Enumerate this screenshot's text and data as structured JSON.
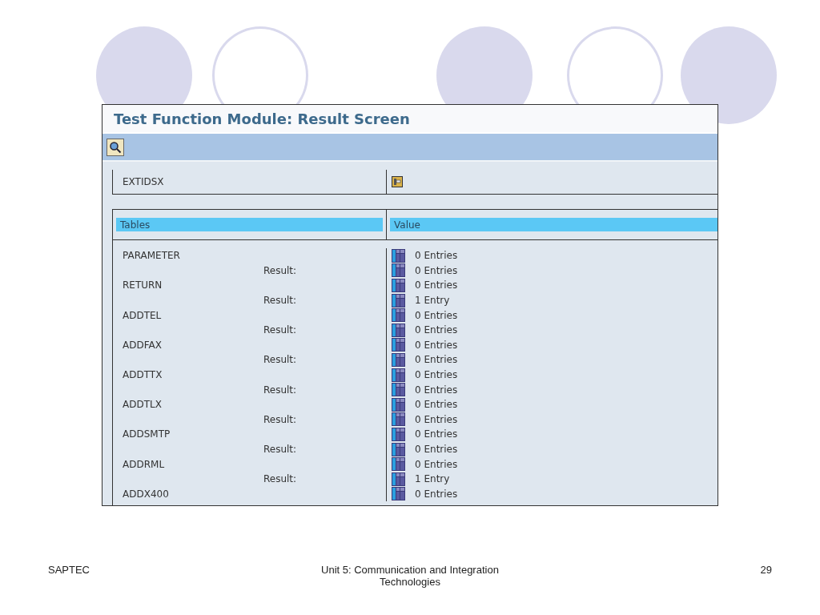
{
  "window": {
    "title": "Test Function Module: Result Screen"
  },
  "toolbar": {
    "buttons": [
      {
        "kind": "search"
      }
    ]
  },
  "export_row": {
    "label": "EXTIDSX"
  },
  "table": {
    "columns": [
      "Tables",
      "Value"
    ],
    "rows": [
      {
        "kind": "table",
        "label": "PARAMETER",
        "value": "0 Entries"
      },
      {
        "kind": "result",
        "label": "Result:",
        "value": "0 Entries"
      },
      {
        "kind": "table",
        "label": "RETURN",
        "value": "0 Entries"
      },
      {
        "kind": "result",
        "label": "Result:",
        "value": "1 Entry"
      },
      {
        "kind": "table",
        "label": "ADDTEL",
        "value": "0 Entries"
      },
      {
        "kind": "result",
        "label": "Result:",
        "value": "0 Entries"
      },
      {
        "kind": "table",
        "label": "ADDFAX",
        "value": "0 Entries"
      },
      {
        "kind": "result",
        "label": "Result:",
        "value": "0 Entries"
      },
      {
        "kind": "table",
        "label": "ADDTTX",
        "value": "0 Entries"
      },
      {
        "kind": "result",
        "label": "Result:",
        "value": "0 Entries"
      },
      {
        "kind": "table",
        "label": "ADDTLX",
        "value": "0 Entries"
      },
      {
        "kind": "result",
        "label": "Result:",
        "value": "0 Entries"
      },
      {
        "kind": "table",
        "label": "ADDSMTP",
        "value": "0 Entries"
      },
      {
        "kind": "result",
        "label": "Result:",
        "value": "0 Entries"
      },
      {
        "kind": "table",
        "label": "ADDRML",
        "value": "0 Entries"
      },
      {
        "kind": "result",
        "label": "Result:",
        "value": "1 Entry"
      },
      {
        "kind": "table",
        "label": "ADDX400",
        "value": "0 Entries"
      }
    ]
  },
  "footer": {
    "left": "SAPTEC",
    "center": "Unit 5: Communication and Integration Technologies",
    "page": "29"
  }
}
